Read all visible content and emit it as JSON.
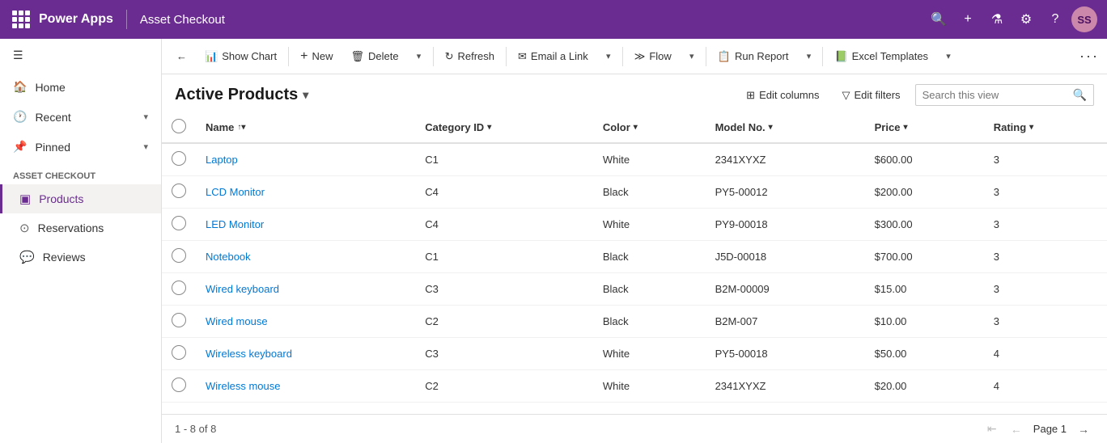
{
  "topbar": {
    "app_name": "Power Apps",
    "page_title": "Asset Checkout",
    "avatar_initials": "SS"
  },
  "sidebar": {
    "hamburger_label": "☰",
    "nav_items": [
      {
        "id": "home",
        "label": "Home",
        "icon": "🏠"
      },
      {
        "id": "recent",
        "label": "Recent",
        "icon": "🕐",
        "has_arrow": true
      },
      {
        "id": "pinned",
        "label": "Pinned",
        "icon": "📌",
        "has_arrow": true
      }
    ],
    "section_label": "Asset Checkout",
    "menu_items": [
      {
        "id": "products",
        "label": "Products",
        "icon": "📦",
        "active": true
      },
      {
        "id": "reservations",
        "label": "Reservations",
        "icon": "⊙"
      },
      {
        "id": "reviews",
        "label": "Reviews",
        "icon": "💬"
      }
    ]
  },
  "commandbar": {
    "buttons": [
      {
        "id": "show-chart",
        "label": "Show Chart",
        "icon": "📊"
      },
      {
        "id": "new",
        "label": "New",
        "icon": "+"
      },
      {
        "id": "delete",
        "label": "Delete",
        "icon": "🗑"
      },
      {
        "id": "refresh",
        "label": "Refresh",
        "icon": "↻"
      },
      {
        "id": "email-link",
        "label": "Email a Link",
        "icon": "✉"
      },
      {
        "id": "flow",
        "label": "Flow",
        "icon": "≫"
      },
      {
        "id": "run-report",
        "label": "Run Report",
        "icon": "📋"
      },
      {
        "id": "excel-templates",
        "label": "Excel Templates",
        "icon": "📗"
      }
    ]
  },
  "list": {
    "title": "Active Products",
    "edit_columns_label": "Edit columns",
    "edit_filters_label": "Edit filters",
    "search_placeholder": "Search this view",
    "columns": [
      {
        "id": "name",
        "label": "Name",
        "sortable": true,
        "sorted": "asc"
      },
      {
        "id": "category",
        "label": "Category ID",
        "sortable": true
      },
      {
        "id": "color",
        "label": "Color",
        "sortable": true
      },
      {
        "id": "model",
        "label": "Model No.",
        "sortable": true
      },
      {
        "id": "price",
        "label": "Price",
        "sortable": true
      },
      {
        "id": "rating",
        "label": "Rating",
        "sortable": true
      }
    ],
    "rows": [
      {
        "name": "Laptop",
        "category": "C1",
        "color": "White",
        "model": "2341XYXZ",
        "price": "$600.00",
        "rating": "3"
      },
      {
        "name": "LCD Monitor",
        "category": "C4",
        "color": "Black",
        "model": "PY5-00012",
        "price": "$200.00",
        "rating": "3"
      },
      {
        "name": "LED Monitor",
        "category": "C4",
        "color": "White",
        "model": "PY9-00018",
        "price": "$300.00",
        "rating": "3"
      },
      {
        "name": "Notebook",
        "category": "C1",
        "color": "Black",
        "model": "J5D-00018",
        "price": "$700.00",
        "rating": "3"
      },
      {
        "name": "Wired keyboard",
        "category": "C3",
        "color": "Black",
        "model": "B2M-00009",
        "price": "$15.00",
        "rating": "3"
      },
      {
        "name": "Wired mouse",
        "category": "C2",
        "color": "Black",
        "model": "B2M-007",
        "price": "$10.00",
        "rating": "3"
      },
      {
        "name": "Wireless keyboard",
        "category": "C3",
        "color": "White",
        "model": "PY5-00018",
        "price": "$50.00",
        "rating": "4"
      },
      {
        "name": "Wireless mouse",
        "category": "C2",
        "color": "White",
        "model": "2341XYXZ",
        "price": "$20.00",
        "rating": "4"
      }
    ],
    "count_label": "1 - 8 of 8",
    "page_label": "Page 1"
  }
}
